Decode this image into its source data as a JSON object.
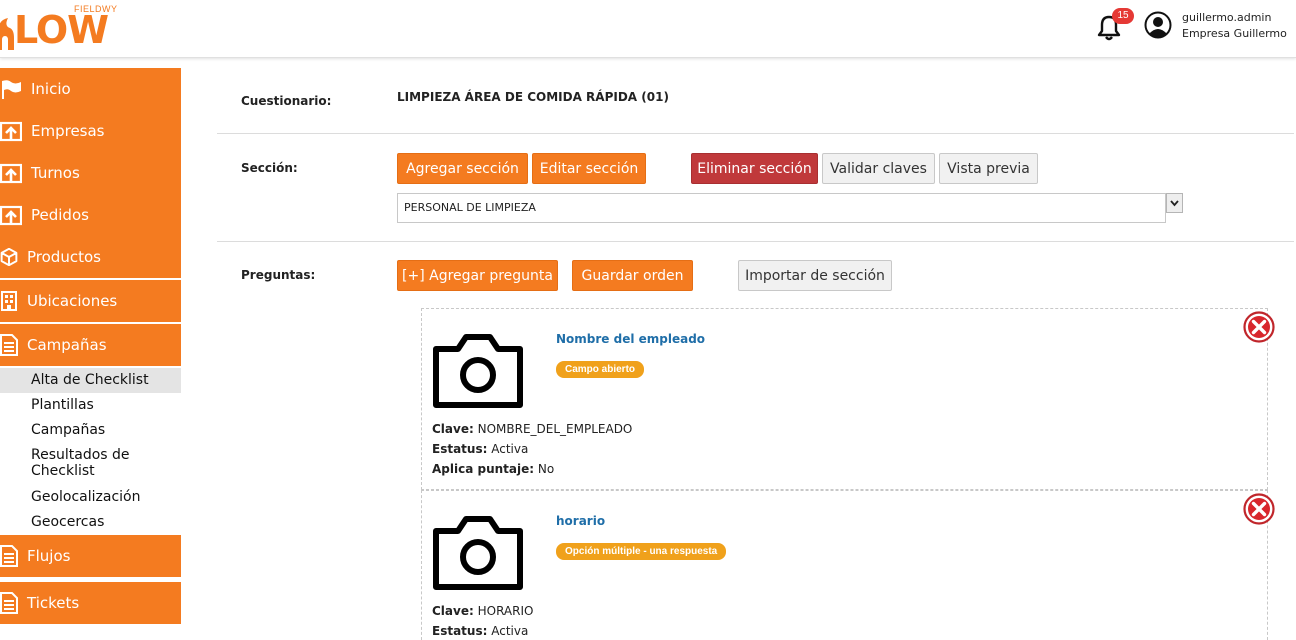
{
  "header": {
    "logo_sup": "FIELDWY",
    "logo_main": "LOW",
    "notifications_count": "15",
    "user_name": "guillermo.admin",
    "user_company": "Empresa Guillermo"
  },
  "sidebar": {
    "items": [
      {
        "label": "Inicio",
        "icon": "flag-icon"
      },
      {
        "label": "Empresas",
        "icon": "upload-box-icon"
      },
      {
        "label": "Turnos",
        "icon": "upload-box-icon"
      },
      {
        "label": "Pedidos",
        "icon": "upload-box-icon"
      },
      {
        "label": "Productos",
        "icon": "cube-icon"
      },
      {
        "label": "Ubicaciones",
        "icon": "building-icon"
      },
      {
        "label": "Campañas",
        "icon": "document-icon"
      },
      {
        "label": "Flujos",
        "icon": "document-icon"
      },
      {
        "label": "Tickets",
        "icon": "document-icon"
      }
    ],
    "sub_items": [
      {
        "label": "Alta de Checklist"
      },
      {
        "label": "Plantillas"
      },
      {
        "label": "Campañas"
      },
      {
        "label": "Resultados de Checklist"
      },
      {
        "label": "Geolocalización"
      },
      {
        "label": "Geocercas"
      }
    ],
    "accent_color": "#f47b20"
  },
  "content": {
    "cuestionario_label": "Cuestionario:",
    "cuestionario_value": "LIMPIEZA ÁREA DE COMIDA RÁPIDA (01)",
    "seccion_label": "Sección:",
    "seccion_buttons": {
      "add": "Agregar sección",
      "edit": "Editar sección",
      "delete": "Eliminar sección",
      "validate": "Validar claves",
      "preview": "Vista previa"
    },
    "seccion_selected": "PERSONAL DE LIMPIEZA",
    "preguntas_label": "Preguntas:",
    "preguntas_buttons": {
      "add": "[+] Agregar pregunta",
      "save_order": "Guardar orden",
      "import": "Importar de sección"
    },
    "questions": [
      {
        "title": "Nombre del empleado",
        "tag": "Campo abierto",
        "clave_label": "Clave:",
        "clave": "NOMBRE_DEL_EMPLEADO",
        "estatus_label": "Estatus:",
        "estatus": "Activa",
        "puntaje_label": "Aplica puntaje:",
        "puntaje": "No"
      },
      {
        "title": "horario",
        "tag": "Opción múltiple - una respuesta",
        "clave_label": "Clave:",
        "clave": "HORARIO",
        "estatus_label": "Estatus:",
        "estatus": "Activa"
      }
    ]
  }
}
